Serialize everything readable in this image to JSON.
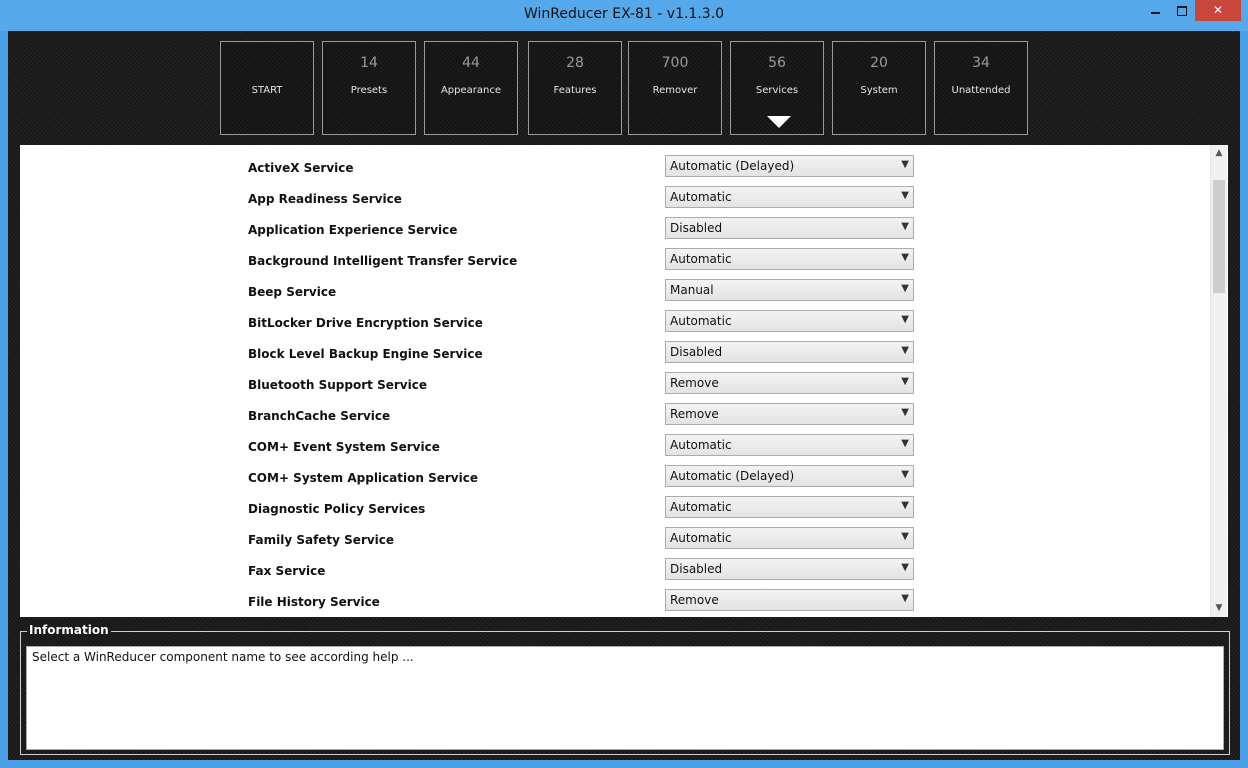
{
  "window": {
    "title": "WinReducer EX-81 - v1.1.3.0",
    "close_glyph": "✕"
  },
  "tiles": [
    {
      "count": "",
      "label": "START"
    },
    {
      "count": "14",
      "label": "Presets"
    },
    {
      "count": "44",
      "label": "Appearance"
    },
    {
      "count": "28",
      "label": "Features"
    },
    {
      "count": "700",
      "label": "Remover"
    },
    {
      "count": "56",
      "label": "Services",
      "selected": true
    },
    {
      "count": "20",
      "label": "System"
    },
    {
      "count": "34",
      "label": "Unattended"
    }
  ],
  "services": [
    {
      "name": "ActiveX Service",
      "value": "Automatic (Delayed)"
    },
    {
      "name": "App Readiness Service",
      "value": "Automatic"
    },
    {
      "name": "Application Experience Service",
      "value": "Disabled"
    },
    {
      "name": "Background Intelligent Transfer Service",
      "value": "Automatic"
    },
    {
      "name": "Beep Service",
      "value": "Manual"
    },
    {
      "name": "BitLocker Drive Encryption Service",
      "value": "Automatic"
    },
    {
      "name": "Block Level Backup Engine Service",
      "value": "Disabled"
    },
    {
      "name": "Bluetooth Support Service",
      "value": "Remove"
    },
    {
      "name": "BranchCache Service",
      "value": "Remove"
    },
    {
      "name": "COM+ Event System Service",
      "value": "Automatic"
    },
    {
      "name": "COM+ System Application Service",
      "value": "Automatic (Delayed)"
    },
    {
      "name": "Diagnostic Policy Services",
      "value": "Automatic"
    },
    {
      "name": "Family Safety Service",
      "value": "Automatic"
    },
    {
      "name": "Fax Service",
      "value": "Disabled"
    },
    {
      "name": "File History Service",
      "value": "Remove"
    }
  ],
  "information": {
    "legend": "Information",
    "text": "Select a WinReducer component name to see according help ..."
  },
  "icons": {
    "dropdown": "chevron-down-icon",
    "scroll_up": "scroll-up-arrow-icon",
    "scroll_down": "scroll-down-arrow-icon",
    "selected_tile": "triangle-down-icon"
  }
}
